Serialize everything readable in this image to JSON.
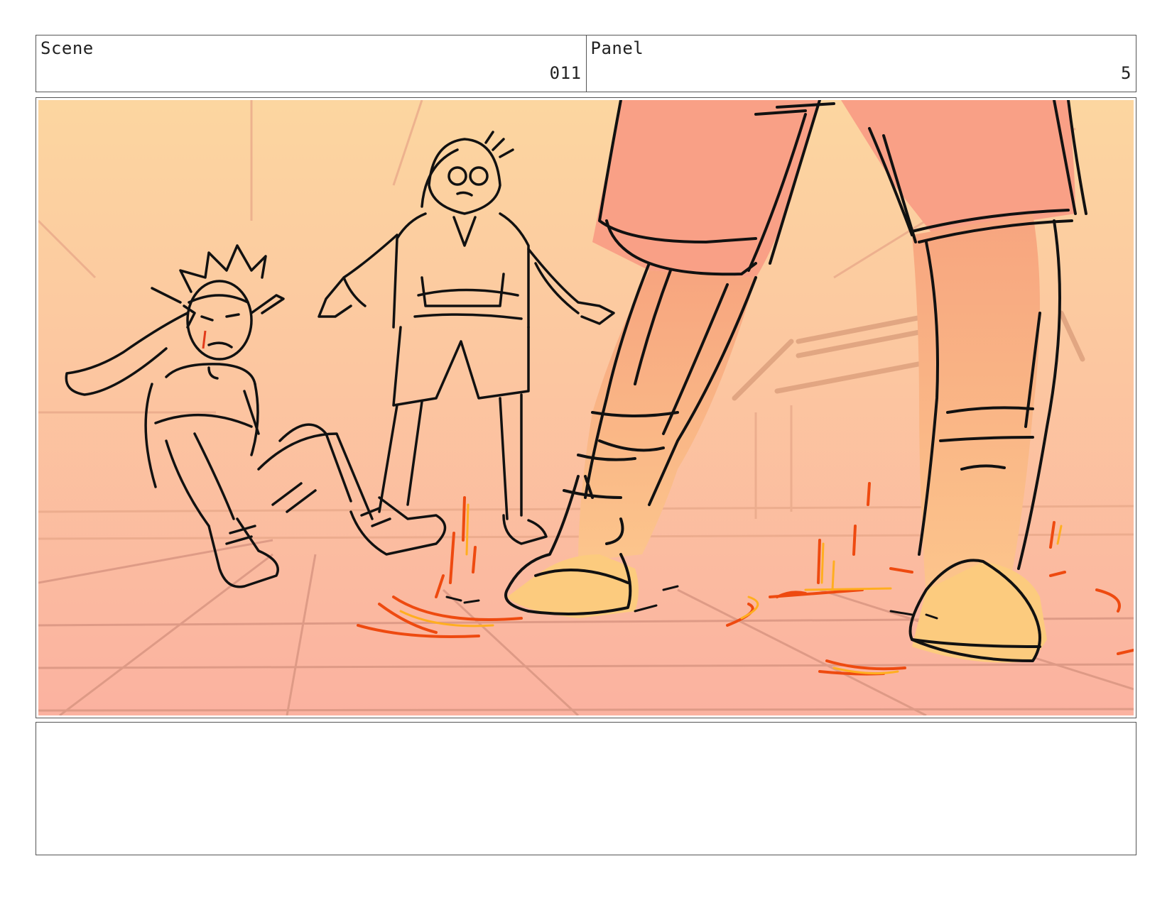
{
  "header": {
    "scene_label": "Scene",
    "scene_value": "011",
    "panel_label": "Panel",
    "panel_value": "5"
  },
  "panel_image": {
    "icon": "storyboard-sketch-illustration",
    "colors": {
      "bg_top": "#fcd6a0",
      "bg_bottom": "#fbb2a0",
      "shorts": "#f9a086",
      "leg_top": "#f7a57f",
      "shoe": "#fccb7e",
      "ink": "#111111",
      "fire": "#ee4a10",
      "fire_light": "#ffae20"
    }
  },
  "notes": {
    "text": ""
  }
}
